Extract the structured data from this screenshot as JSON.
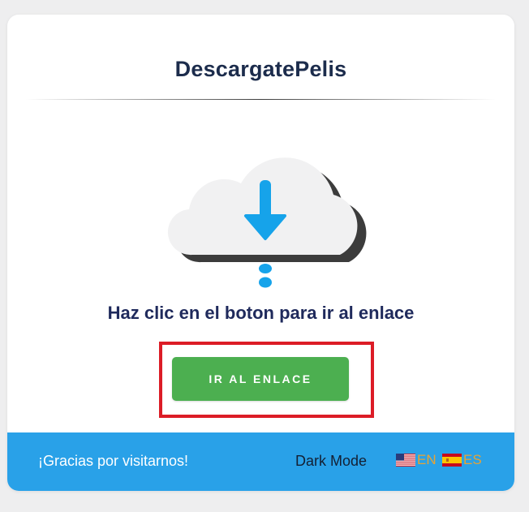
{
  "card": {
    "title": "DescargatePelis",
    "prompt": "Haz clic en el boton para ir al enlace",
    "button_label": "IR AL ENLACE"
  },
  "icon": {
    "name": "cloud-download-icon",
    "accent_color": "#16a3ea"
  },
  "footer": {
    "thanks": "¡Gracias por visitarnos!",
    "dark_mode_label": "Dark Mode",
    "languages": [
      {
        "code": "EN",
        "flag": "us-flag-icon"
      },
      {
        "code": "ES",
        "flag": "es-flag-icon"
      }
    ]
  },
  "colors": {
    "background": "#eeeeef",
    "title": "#1c2c4c",
    "button": "#4caf50",
    "highlight_border": "#dc1c26",
    "footer": "#29a1e8",
    "language_text": "#e8a334"
  }
}
